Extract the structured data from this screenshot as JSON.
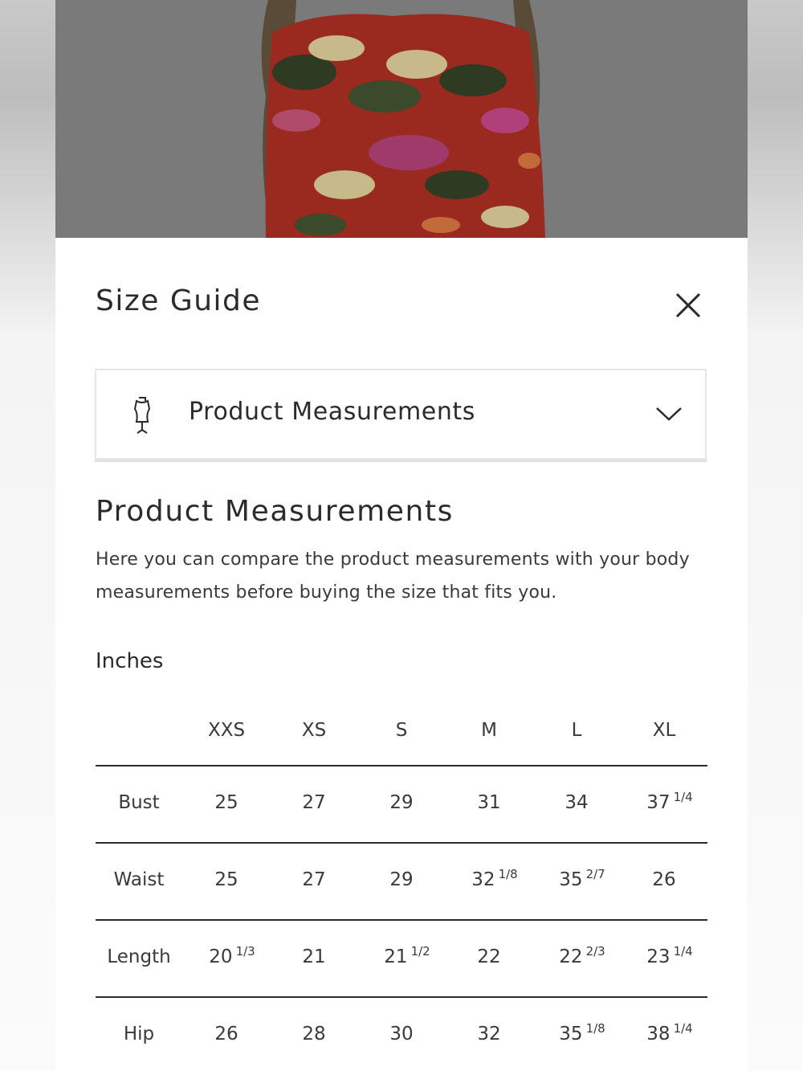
{
  "modal": {
    "title": "Size Guide",
    "close_icon": "close-icon"
  },
  "dropdown": {
    "icon": "dress-form-icon",
    "label": "Product Measurements",
    "chevron": "chevron-down-icon"
  },
  "section": {
    "title": "Product Measurements",
    "description": "Here you can compare the product measurements with your body measurements before buying the size that fits you."
  },
  "table": {
    "unit": "Inches",
    "columns": [
      "XXS",
      "XS",
      "S",
      "M",
      "L",
      "XL"
    ],
    "rows": [
      {
        "label": "Bust",
        "values": [
          {
            "w": "25",
            "f": ""
          },
          {
            "w": "27",
            "f": ""
          },
          {
            "w": "29",
            "f": ""
          },
          {
            "w": "31",
            "f": ""
          },
          {
            "w": "34",
            "f": ""
          },
          {
            "w": "37",
            "f": "1/4"
          }
        ]
      },
      {
        "label": "Waist",
        "values": [
          {
            "w": "25",
            "f": ""
          },
          {
            "w": "27",
            "f": ""
          },
          {
            "w": "29",
            "f": ""
          },
          {
            "w": "32",
            "f": "1/8"
          },
          {
            "w": "35",
            "f": "2/7"
          },
          {
            "w": "26",
            "f": ""
          }
        ]
      },
      {
        "label": "Length",
        "values": [
          {
            "w": "20",
            "f": "1/3"
          },
          {
            "w": "21",
            "f": ""
          },
          {
            "w": "21",
            "f": "1/2"
          },
          {
            "w": "22",
            "f": ""
          },
          {
            "w": "22",
            "f": "2/3"
          },
          {
            "w": "23",
            "f": "1/4"
          }
        ]
      },
      {
        "label": "Hip",
        "values": [
          {
            "w": "26",
            "f": ""
          },
          {
            "w": "28",
            "f": ""
          },
          {
            "w": "30",
            "f": ""
          },
          {
            "w": "32",
            "f": ""
          },
          {
            "w": "35",
            "f": "1/8"
          },
          {
            "w": "38",
            "f": "1/4"
          }
        ]
      }
    ]
  }
}
